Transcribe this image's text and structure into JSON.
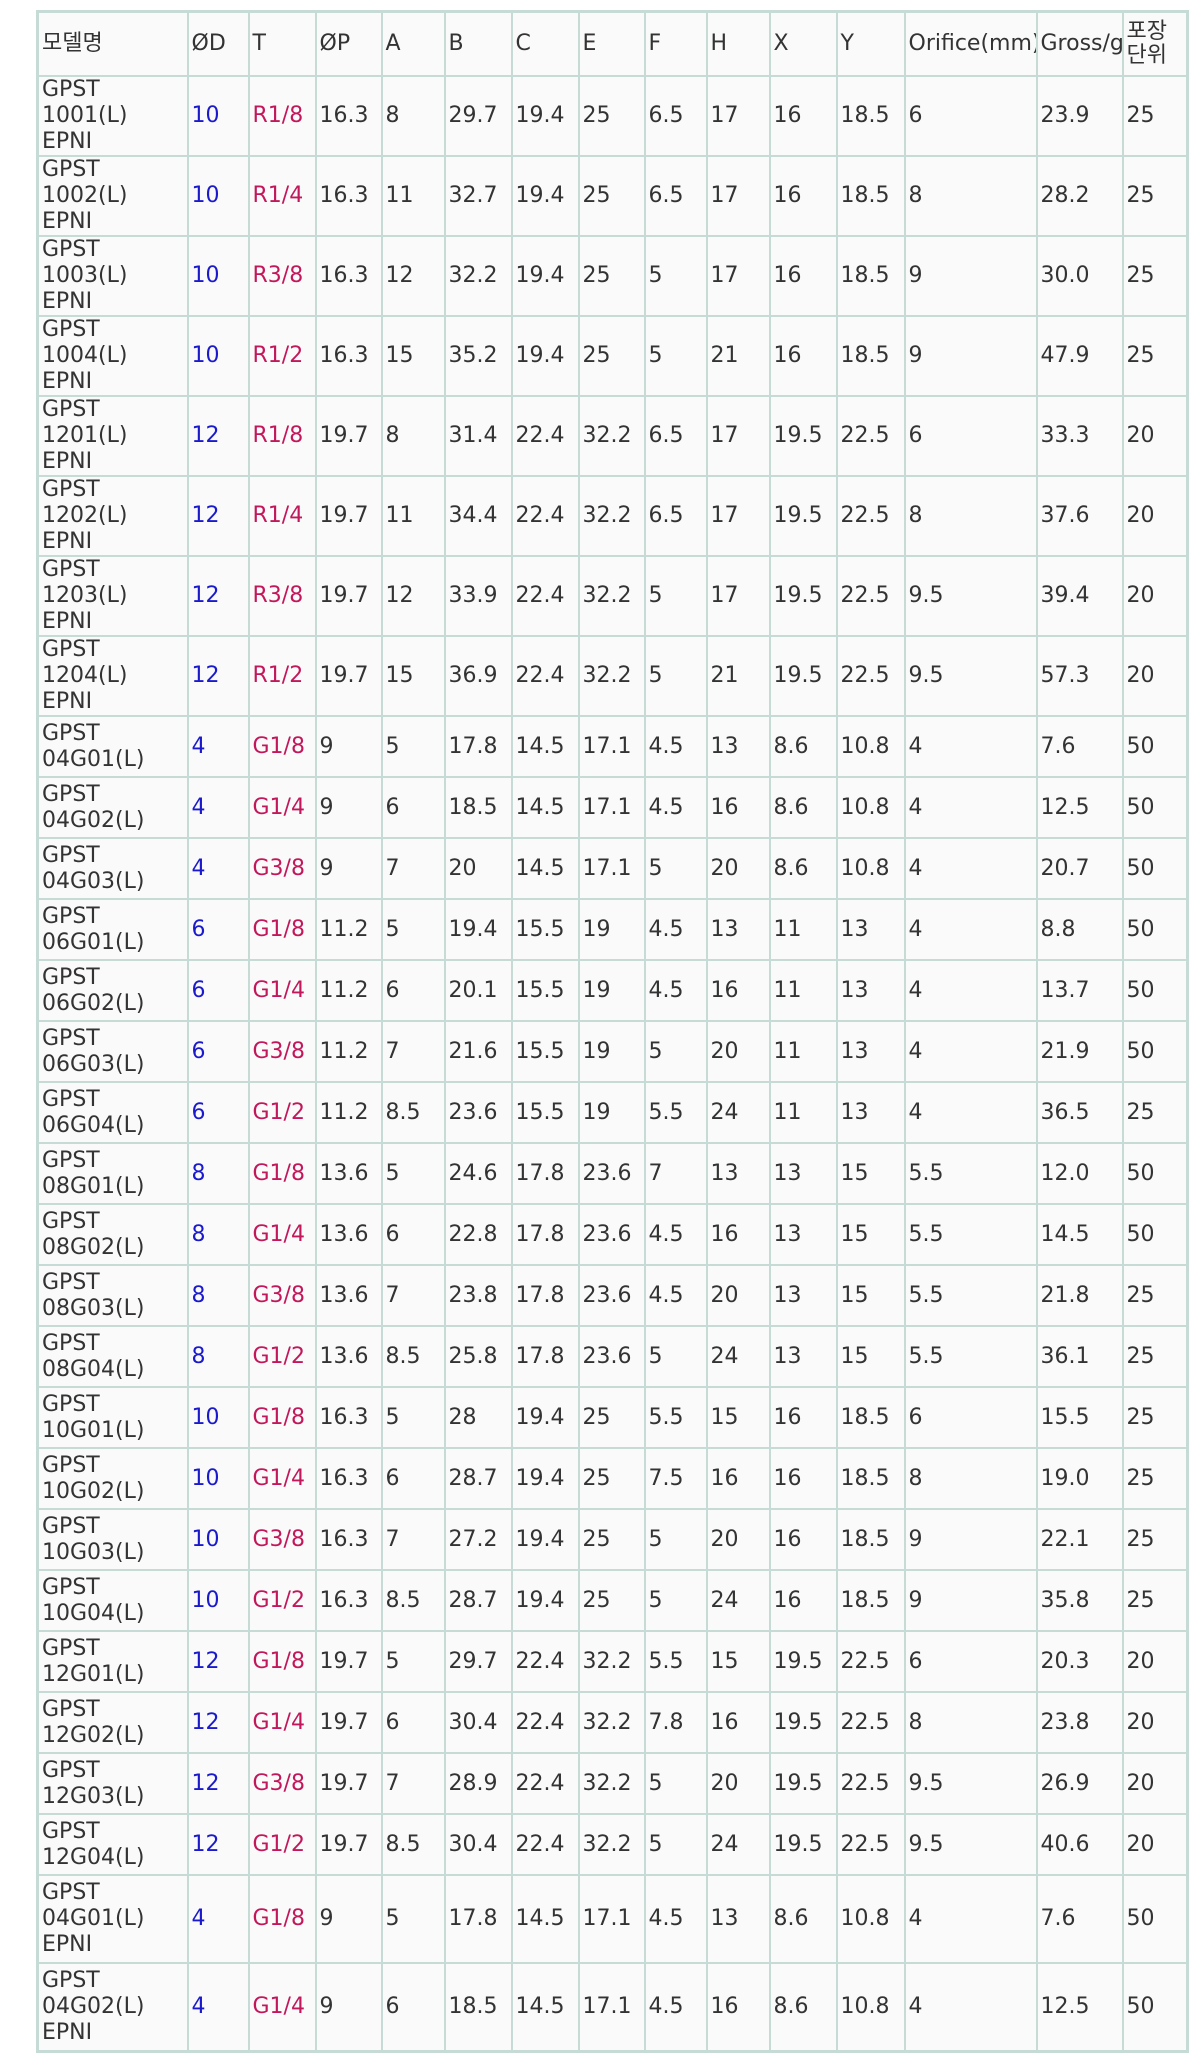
{
  "colors": {
    "od_value": "#1a1acc",
    "thread_value": "#c2185b",
    "text": "#333333",
    "border": "#c6dbd6"
  },
  "table": {
    "headers": [
      "모델명",
      "ØD",
      "T",
      "ØP",
      "A",
      "B",
      "C",
      "E",
      "F",
      "H",
      "X",
      "Y",
      "Orifice(mm)",
      "Gross/g",
      "포장단위"
    ],
    "rows": [
      [
        "GPST 1001(L) EPNI",
        "10",
        "R1/8",
        "16.3",
        "8",
        "29.7",
        "19.4",
        "25",
        "6.5",
        "17",
        "16",
        "18.5",
        "6",
        "23.9",
        "25"
      ],
      [
        "GPST 1002(L) EPNI",
        "10",
        "R1/4",
        "16.3",
        "11",
        "32.7",
        "19.4",
        "25",
        "6.5",
        "17",
        "16",
        "18.5",
        "8",
        "28.2",
        "25"
      ],
      [
        "GPST 1003(L) EPNI",
        "10",
        "R3/8",
        "16.3",
        "12",
        "32.2",
        "19.4",
        "25",
        "5",
        "17",
        "16",
        "18.5",
        "9",
        "30.0",
        "25"
      ],
      [
        "GPST 1004(L) EPNI",
        "10",
        "R1/2",
        "16.3",
        "15",
        "35.2",
        "19.4",
        "25",
        "5",
        "21",
        "16",
        "18.5",
        "9",
        "47.9",
        "25"
      ],
      [
        "GPST 1201(L) EPNI",
        "12",
        "R1/8",
        "19.7",
        "8",
        "31.4",
        "22.4",
        "32.2",
        "6.5",
        "17",
        "19.5",
        "22.5",
        "6",
        "33.3",
        "20"
      ],
      [
        "GPST 1202(L) EPNI",
        "12",
        "R1/4",
        "19.7",
        "11",
        "34.4",
        "22.4",
        "32.2",
        "6.5",
        "17",
        "19.5",
        "22.5",
        "8",
        "37.6",
        "20"
      ],
      [
        "GPST 1203(L) EPNI",
        "12",
        "R3/8",
        "19.7",
        "12",
        "33.9",
        "22.4",
        "32.2",
        "5",
        "17",
        "19.5",
        "22.5",
        "9.5",
        "39.4",
        "20"
      ],
      [
        "GPST 1204(L) EPNI",
        "12",
        "R1/2",
        "19.7",
        "15",
        "36.9",
        "22.4",
        "32.2",
        "5",
        "21",
        "19.5",
        "22.5",
        "9.5",
        "57.3",
        "20"
      ],
      [
        "GPST 04G01(L)",
        "4",
        "G1/8",
        "9",
        "5",
        "17.8",
        "14.5",
        "17.1",
        "4.5",
        "13",
        "8.6",
        "10.8",
        "4",
        "7.6",
        "50"
      ],
      [
        "GPST 04G02(L)",
        "4",
        "G1/4",
        "9",
        "6",
        "18.5",
        "14.5",
        "17.1",
        "4.5",
        "16",
        "8.6",
        "10.8",
        "4",
        "12.5",
        "50"
      ],
      [
        "GPST 04G03(L)",
        "4",
        "G3/8",
        "9",
        "7",
        "20",
        "14.5",
        "17.1",
        "5",
        "20",
        "8.6",
        "10.8",
        "4",
        "20.7",
        "50"
      ],
      [
        "GPST 06G01(L)",
        "6",
        "G1/8",
        "11.2",
        "5",
        "19.4",
        "15.5",
        "19",
        "4.5",
        "13",
        "11",
        "13",
        "4",
        "8.8",
        "50"
      ],
      [
        "GPST 06G02(L)",
        "6",
        "G1/4",
        "11.2",
        "6",
        "20.1",
        "15.5",
        "19",
        "4.5",
        "16",
        "11",
        "13",
        "4",
        "13.7",
        "50"
      ],
      [
        "GPST 06G03(L)",
        "6",
        "G3/8",
        "11.2",
        "7",
        "21.6",
        "15.5",
        "19",
        "5",
        "20",
        "11",
        "13",
        "4",
        "21.9",
        "50"
      ],
      [
        "GPST 06G04(L)",
        "6",
        "G1/2",
        "11.2",
        "8.5",
        "23.6",
        "15.5",
        "19",
        "5.5",
        "24",
        "11",
        "13",
        "4",
        "36.5",
        "25"
      ],
      [
        "GPST 08G01(L)",
        "8",
        "G1/8",
        "13.6",
        "5",
        "24.6",
        "17.8",
        "23.6",
        "7",
        "13",
        "13",
        "15",
        "5.5",
        "12.0",
        "50"
      ],
      [
        "GPST 08G02(L)",
        "8",
        "G1/4",
        "13.6",
        "6",
        "22.8",
        "17.8",
        "23.6",
        "4.5",
        "16",
        "13",
        "15",
        "5.5",
        "14.5",
        "50"
      ],
      [
        "GPST 08G03(L)",
        "8",
        "G3/8",
        "13.6",
        "7",
        "23.8",
        "17.8",
        "23.6",
        "4.5",
        "20",
        "13",
        "15",
        "5.5",
        "21.8",
        "25"
      ],
      [
        "GPST 08G04(L)",
        "8",
        "G1/2",
        "13.6",
        "8.5",
        "25.8",
        "17.8",
        "23.6",
        "5",
        "24",
        "13",
        "15",
        "5.5",
        "36.1",
        "25"
      ],
      [
        "GPST 10G01(L)",
        "10",
        "G1/8",
        "16.3",
        "5",
        "28",
        "19.4",
        "25",
        "5.5",
        "15",
        "16",
        "18.5",
        "6",
        "15.5",
        "25"
      ],
      [
        "GPST 10G02(L)",
        "10",
        "G1/4",
        "16.3",
        "6",
        "28.7",
        "19.4",
        "25",
        "7.5",
        "16",
        "16",
        "18.5",
        "8",
        "19.0",
        "25"
      ],
      [
        "GPST 10G03(L)",
        "10",
        "G3/8",
        "16.3",
        "7",
        "27.2",
        "19.4",
        "25",
        "5",
        "20",
        "16",
        "18.5",
        "9",
        "22.1",
        "25"
      ],
      [
        "GPST 10G04(L)",
        "10",
        "G1/2",
        "16.3",
        "8.5",
        "28.7",
        "19.4",
        "25",
        "5",
        "24",
        "16",
        "18.5",
        "9",
        "35.8",
        "25"
      ],
      [
        "GPST 12G01(L)",
        "12",
        "G1/8",
        "19.7",
        "5",
        "29.7",
        "22.4",
        "32.2",
        "5.5",
        "15",
        "19.5",
        "22.5",
        "6",
        "20.3",
        "20"
      ],
      [
        "GPST 12G02(L)",
        "12",
        "G1/4",
        "19.7",
        "6",
        "30.4",
        "22.4",
        "32.2",
        "7.8",
        "16",
        "19.5",
        "22.5",
        "8",
        "23.8",
        "20"
      ],
      [
        "GPST 12G03(L)",
        "12",
        "G3/8",
        "19.7",
        "7",
        "28.9",
        "22.4",
        "32.2",
        "5",
        "20",
        "19.5",
        "22.5",
        "9.5",
        "26.9",
        "20"
      ],
      [
        "GPST 12G04(L)",
        "12",
        "G1/2",
        "19.7",
        "8.5",
        "30.4",
        "22.4",
        "32.2",
        "5",
        "24",
        "19.5",
        "22.5",
        "9.5",
        "40.6",
        "20"
      ],
      [
        "GPST 04G01(L) EPNI",
        "4",
        "G1/8",
        "9",
        "5",
        "17.8",
        "14.5",
        "17.1",
        "4.5",
        "13",
        "8.6",
        "10.8",
        "4",
        "7.6",
        "50"
      ],
      [
        "GPST 04G02(L) EPNI",
        "4",
        "G1/4",
        "9",
        "6",
        "18.5",
        "14.5",
        "17.1",
        "4.5",
        "16",
        "8.6",
        "10.8",
        "4",
        "12.5",
        "50"
      ]
    ]
  }
}
